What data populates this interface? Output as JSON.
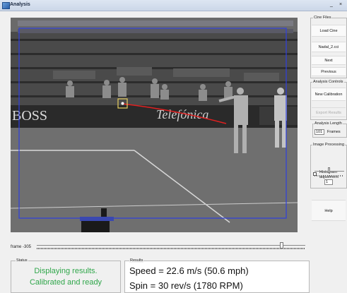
{
  "window": {
    "title": "Analysis",
    "minimize": "_",
    "close": "×"
  },
  "video": {
    "frame_label": "frame -305",
    "scoreboard_brand": "BOSS",
    "sponsor": "Telefónica",
    "colors": {
      "tracking_box": "#2e3fe0",
      "ball_box": "#e8d060",
      "trajectory": "#e02020"
    }
  },
  "status": {
    "label": "Status",
    "line1": "Displaying results.",
    "line2": "Calibrated and ready"
  },
  "results": {
    "label": "Results",
    "speed": "Speed = 22.6 m/s (50.6 mph)",
    "spin": "Spin = 30 rev/s (1780 RPM)"
  },
  "sidebar": {
    "cine_files_label": "Cine Files",
    "load_cine": "Load Cine",
    "filename": "Nadal_2.cci",
    "next": "Next",
    "previous": "Previous",
    "analysis_controls_label": "Analysis Controls",
    "new_calibration": "New Calibration",
    "export_results": "Export Results",
    "analysis_length_label": "Analysis Length",
    "analysis_length_value": "101",
    "frames_label": "Frames",
    "image_processing_label": "Image Processing",
    "histogram_label_1": "Histogram",
    "histogram_label_2": "adjustment",
    "spin_value": "1",
    "help": "Help"
  }
}
